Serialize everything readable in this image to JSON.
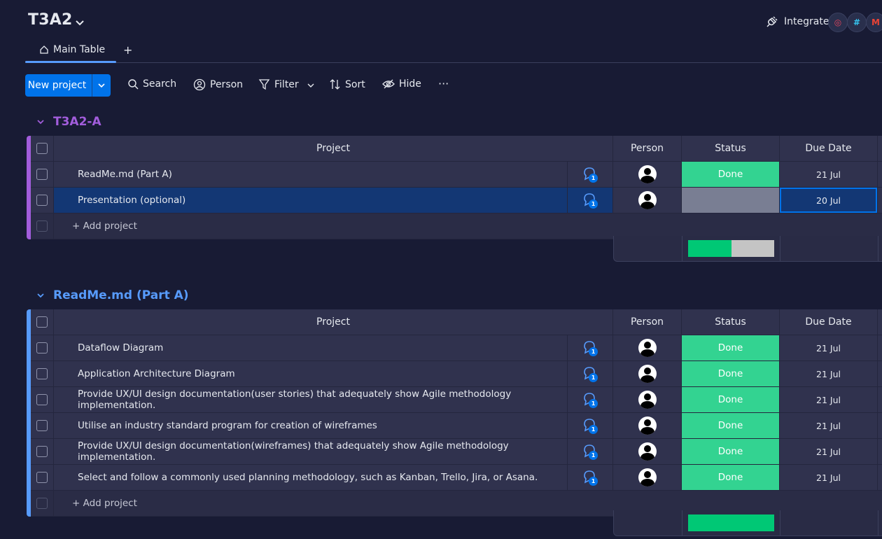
{
  "board": {
    "title": "T3A2"
  },
  "integrate": {
    "label": "Integrate"
  },
  "tabs": {
    "main_table": "Main Table",
    "add": "+"
  },
  "toolbar": {
    "new_project": "New project",
    "search": "Search",
    "person": "Person",
    "filter": "Filter",
    "sort": "Sort",
    "hide": "Hide",
    "more": "···"
  },
  "columns": {
    "project": "Project",
    "person": "Person",
    "status": "Status",
    "due_date": "Due Date"
  },
  "colors": {
    "done": "#33d391",
    "empty_status": "#797e93",
    "group_a": "#a25ddc",
    "group_b": "#579bfc"
  },
  "groups": [
    {
      "title": "T3A2-A",
      "add_label": "+ Add project",
      "rows": [
        {
          "name": "ReadMe.md (Part A)",
          "updates": "1",
          "status": "Done",
          "due": "21 Jul"
        },
        {
          "name": "Presentation (optional)",
          "updates": "1",
          "status": "",
          "due": "20 Jul"
        }
      ],
      "status_summary": {
        "done_fraction": 0.5
      }
    },
    {
      "title": "ReadMe.md (Part A)",
      "add_label": "+ Add project",
      "rows": [
        {
          "name": "Dataflow Diagram",
          "updates": "1",
          "status": "Done",
          "due": "21 Jul"
        },
        {
          "name": "Application Architecture Diagram",
          "updates": "1",
          "status": "Done",
          "due": "21 Jul"
        },
        {
          "name": "Provide UX/UI design documentation(user stories) that adequately show Agile methodology implementation.",
          "updates": "1",
          "status": "Done",
          "due": "21 Jul"
        },
        {
          "name": "Utilise an industry standard program for creation of wireframes",
          "updates": "1",
          "status": "Done",
          "due": "21 Jul"
        },
        {
          "name": "Provide UX/UI design documentation(wireframes) that adequately show Agile methodology implementation.",
          "updates": "1",
          "status": "Done",
          "due": "21 Jul"
        },
        {
          "name": "Select and follow a commonly used planning methodology, such as Kanban, Trello, Jira, or Asana.",
          "updates": "1",
          "status": "Done",
          "due": "21 Jul"
        }
      ],
      "status_summary": {
        "done_fraction": 1.0
      }
    }
  ]
}
